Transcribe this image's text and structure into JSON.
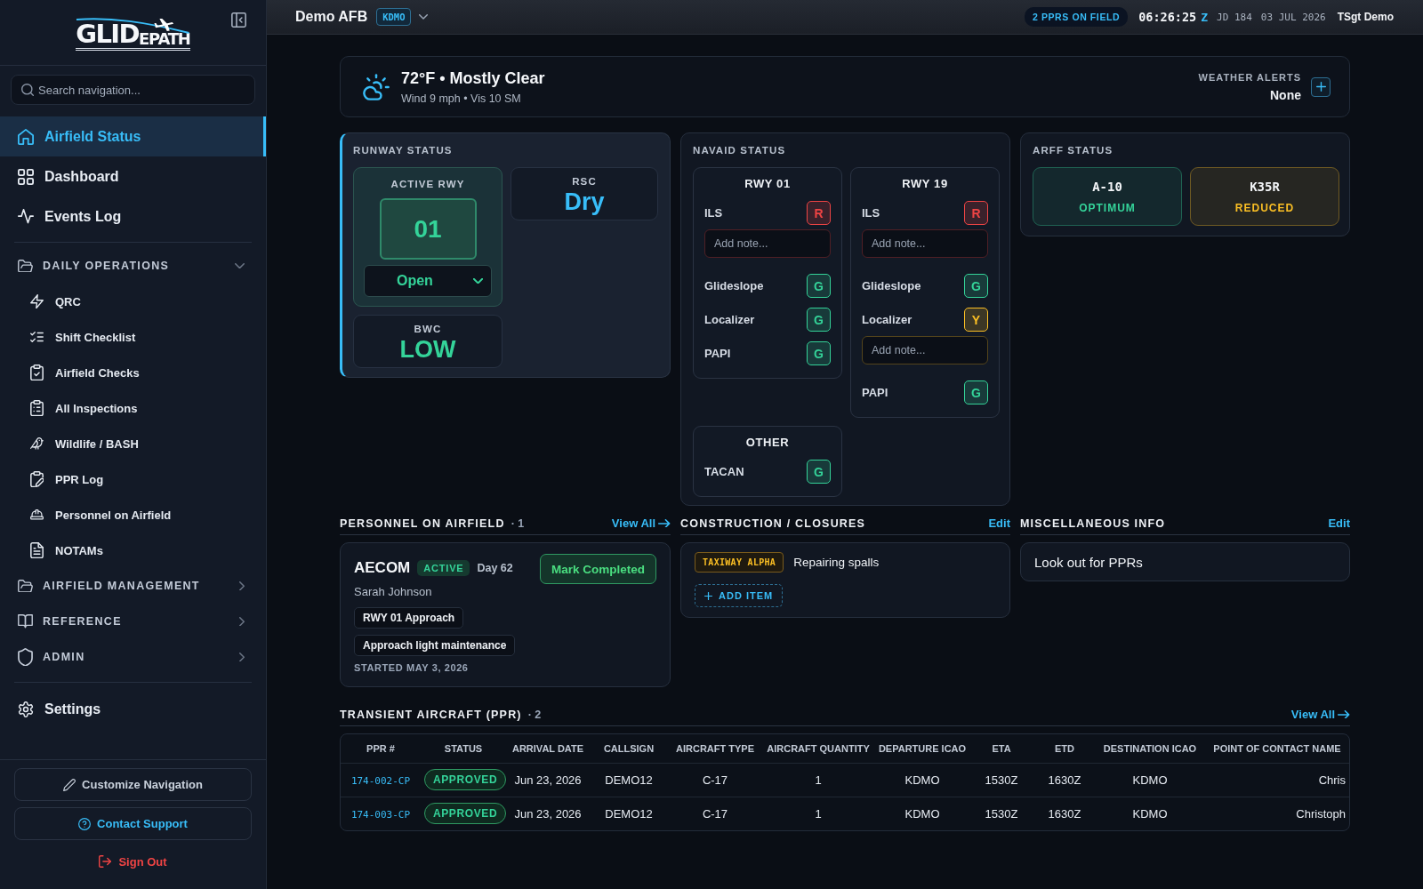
{
  "sidebar": {
    "logo": "GLIDEPATH",
    "search": {
      "placeholder": "Search navigation..."
    },
    "primary": [
      {
        "label": "Airfield Status",
        "selected": true
      },
      {
        "label": "Dashboard",
        "selected": false
      },
      {
        "label": "Events Log",
        "selected": false
      }
    ],
    "groups": [
      {
        "label": "DAILY OPERATIONS",
        "expanded": true,
        "children": [
          {
            "label": "QRC",
            "selected": false
          },
          {
            "label": "Shift Checklist",
            "selected": false
          },
          {
            "label": "Airfield Checks",
            "selected": false
          },
          {
            "label": "All Inspections",
            "selected": false
          },
          {
            "label": "Wildlife / BASH",
            "selected": false
          },
          {
            "label": "PPR Log",
            "selected": false
          },
          {
            "label": "Personnel on Airfield",
            "selected": false
          },
          {
            "label": "NOTAMs",
            "selected": false
          }
        ]
      },
      {
        "label": "AIRFIELD MANAGEMENT",
        "expanded": false
      },
      {
        "label": "REFERENCE",
        "expanded": false
      },
      {
        "label": "ADMIN",
        "expanded": false
      }
    ],
    "secondary": [
      {
        "label": "Settings",
        "selected": false
      }
    ],
    "buttons": [
      {
        "kind": "neutral",
        "label": "Customize Navigation"
      },
      {
        "kind": "accent",
        "label": "Contact Support"
      }
    ],
    "sign_out": "Sign Out"
  },
  "topbar": {
    "base": "Demo AFB",
    "icao": "KDMO",
    "ppr_badge": "2 PPRS ON FIELD",
    "time": "06:26:25",
    "zone": "Z",
    "julian": "JD 184",
    "date": "03 JUL 2026",
    "user": "TSgt Demo"
  },
  "weather": {
    "headline": "72°F • Mostly Clear",
    "detail": "Wind 9 mph • Vis 10 SM",
    "alerts_label": "WEATHER ALERTS",
    "alerts_value": "None"
  },
  "runway": {
    "title": "RUNWAY STATUS",
    "active_label": "ACTIVE RWY",
    "active_runway": "01",
    "runway_state": "Open",
    "rsc_label": "RSC",
    "rsc": "Dry",
    "bwc_label": "BWC",
    "bwc": "LOW"
  },
  "navaid": {
    "title": "NAVAID STATUS",
    "groups": [
      {
        "title": "RWY 01",
        "items": [
          {
            "name": "ILS",
            "letter": "R",
            "color": "#ef4444",
            "note": {
              "placeholder": "Add note..."
            }
          },
          {
            "name": "Glideslope",
            "letter": "G",
            "color": "#34d399"
          },
          {
            "name": "Localizer",
            "letter": "G",
            "color": "#34d399"
          },
          {
            "name": "PAPI",
            "letter": "G",
            "color": "#34d399"
          }
        ]
      },
      {
        "title": "RWY 19",
        "items": [
          {
            "name": "ILS",
            "letter": "R",
            "color": "#ef4444",
            "note": {
              "placeholder": "Add note..."
            }
          },
          {
            "name": "Glideslope",
            "letter": "G",
            "color": "#34d399"
          },
          {
            "name": "Localizer",
            "letter": "Y",
            "color": "#fbbf24",
            "note": {
              "placeholder": "Add note..."
            }
          },
          {
            "name": "PAPI",
            "letter": "G",
            "color": "#34d399"
          }
        ]
      },
      {
        "title": "OTHER",
        "items": [
          {
            "name": "TACAN",
            "letter": "G",
            "color": "#34d399"
          }
        ]
      }
    ]
  },
  "arff": {
    "title": "ARFF STATUS",
    "aircraft": [
      {
        "name": "A-10",
        "status": "OPTIMUM",
        "color": "#34d399"
      },
      {
        "name": "K35R",
        "status": "REDUCED",
        "color": "#fbbf24"
      }
    ]
  },
  "personnel": {
    "title": "PERSONNEL ON AIRFIELD",
    "count": "· 1",
    "view_all": "View All",
    "entries": [
      {
        "company": "AECOM",
        "badge": "ACTIVE",
        "day": "Day 62",
        "contact": "Sarah Johnson",
        "tags": [
          "RWY 01 Approach",
          "Approach light maintenance"
        ],
        "started": "STARTED MAY 3, 2026",
        "action": "Mark Completed"
      }
    ]
  },
  "construction": {
    "title": "CONSTRUCTION / CLOSURES",
    "edit": "Edit",
    "items": [
      {
        "tag": "TAXIWAY ALPHA",
        "text": "Repairing spalls"
      }
    ],
    "add_button": "ADD ITEM"
  },
  "misc": {
    "title": "MISCELLANEOUS INFO",
    "edit": "Edit",
    "text": "Look out for PPRs"
  },
  "transient": {
    "title": "TRANSIENT AIRCRAFT (PPR)",
    "count": "· 2",
    "view_all": "View All",
    "table": {
      "columns": [
        "PPR #",
        "STATUS",
        "ARRIVAL DATE",
        "CALLSIGN",
        "AIRCRAFT TYPE",
        "AIRCRAFT QUANTITY",
        "DEPARTURE ICAO",
        "ETA",
        "ETD",
        "DESTINATION ICAO",
        "POINT OF CONTACT NAME"
      ],
      "rows": [
        {
          "cells": [
            "174-002-CP",
            "APPROVED",
            "Jun 23, 2026",
            "DEMO12",
            "C-17",
            "1",
            "KDMO",
            "1530Z",
            "1630Z",
            "KDMO",
            "Chris"
          ]
        },
        {
          "cells": [
            "174-003-CP",
            "APPROVED",
            "Jun 23, 2026",
            "DEMO12",
            "C-17",
            "1",
            "KDMO",
            "1530Z",
            "1630Z",
            "KDMO",
            "Christoph"
          ]
        }
      ]
    }
  }
}
